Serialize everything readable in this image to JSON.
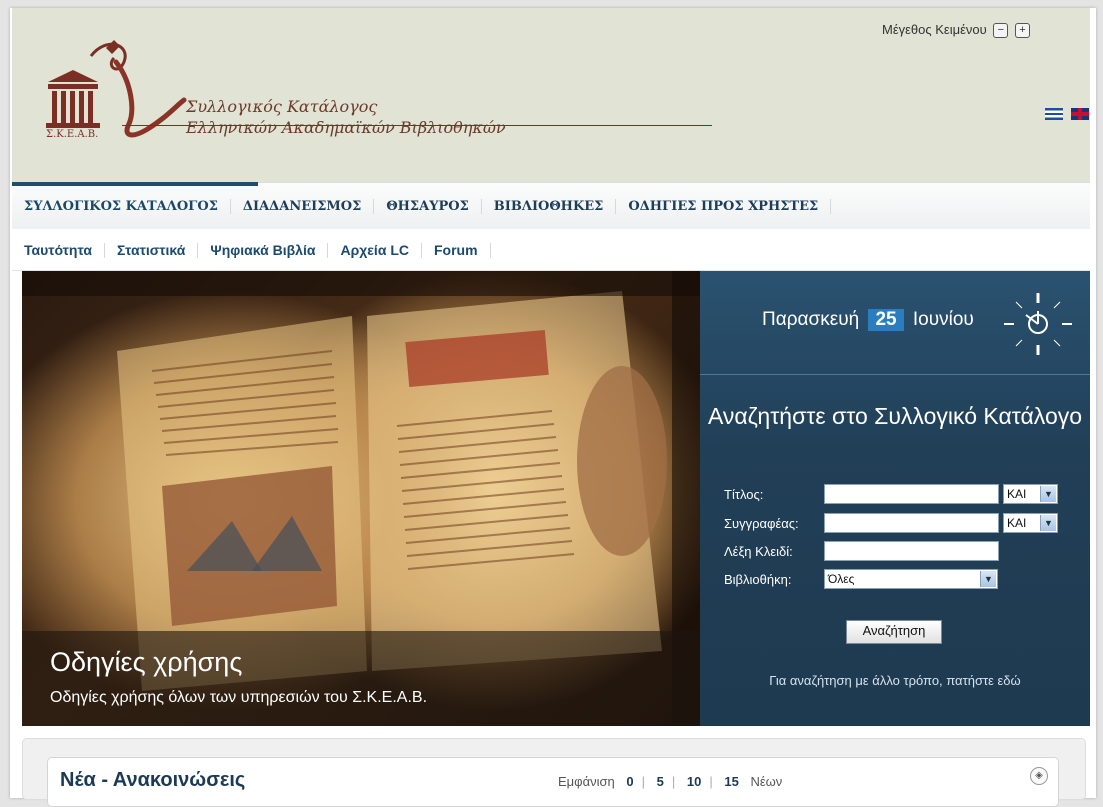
{
  "header": {
    "logo_abbr": "Σ.Κ.Ε.Α.Β.",
    "logo_line1": "Συλλογικός Κατάλογος",
    "logo_line2": "Ελληνικών Ακαδημαϊκών Βιβλιοθηκών",
    "text_size_label": "Μέγεθος Κειμένου",
    "text_size_decrease": "−",
    "text_size_increase": "+"
  },
  "nav_main": [
    "ΣΥΛΛΟΓΙΚΟΣ ΚΑΤΑΛΟΓΟΣ",
    "ΔΙΑΔΑΝΕΙΣΜΟΣ",
    "ΘΗΣΑΥΡΟΣ",
    "ΒΙΒΛΙΟΘΗΚΕΣ",
    "ΟΔΗΓΙΕΣ ΠΡΟΣ ΧΡΗΣΤΕΣ"
  ],
  "nav_sub": [
    "Ταυτότητα",
    "Στατιστικά",
    "Ψηφιακά Βιβλία",
    "Αρχεία LC",
    "Forum"
  ],
  "hero": {
    "title": "Οδηγίες χρήσης",
    "subtitle": "Οδηγίες χρήσης όλων των υπηρεσιών του Σ.Κ.Ε.Α.Β."
  },
  "date": {
    "weekday": "Παρασκευή",
    "day": "25",
    "month": "Ιουνίου"
  },
  "search": {
    "title": "Αναζητήστε στο Συλλογικό Κατάλογο",
    "title_label": "Τίτλος:",
    "title_value": "",
    "title_operator": "ΚΑΙ",
    "author_label": "Συγγραφέας:",
    "author_value": "",
    "author_operator": "ΚΑΙ",
    "keyword_label": "Λέξη Κλειδί:",
    "keyword_value": "",
    "library_label": "Βιβλιοθήκη:",
    "library_value": "Όλες",
    "button": "Αναζήτηση",
    "other_link": "Για αναζήτηση με άλλο τρόπο, πατήστε εδώ"
  },
  "news": {
    "title": "Νέα - Ανακοινώσεις",
    "display_label": "Εμφάνιση",
    "counts": [
      "0",
      "5",
      "10",
      "15"
    ],
    "suffix": "Νέων"
  }
}
